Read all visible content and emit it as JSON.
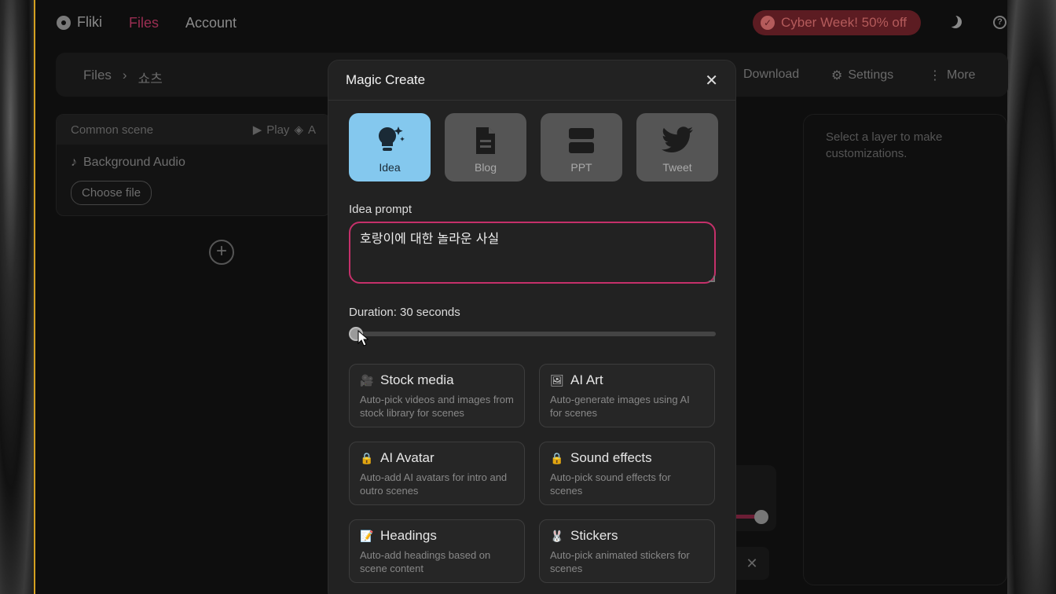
{
  "nav": {
    "brand": "Fliki",
    "files": "Files",
    "account": "Account",
    "promo": "Cyber Week! 50% off"
  },
  "toolbar": {
    "breadcrumb_root": "Files",
    "breadcrumb_sep": "›",
    "breadcrumb_current": "쇼츠",
    "download": "Download",
    "settings": "Settings",
    "more": "More"
  },
  "scene": {
    "title": "Common scene",
    "play": "Play",
    "extra": "A",
    "background_audio": "Background Audio",
    "choose_file": "Choose file"
  },
  "props": {
    "hint": "Select a layer to make customizations."
  },
  "modal": {
    "title": "Magic Create",
    "types": [
      {
        "label": "Idea",
        "icon": "lightbulb-sparkle-icon",
        "active": true
      },
      {
        "label": "Blog",
        "icon": "document-icon",
        "active": false
      },
      {
        "label": "PPT",
        "icon": "slides-icon",
        "active": false
      },
      {
        "label": "Tweet",
        "icon": "twitter-bird-icon",
        "active": false
      }
    ],
    "prompt_label": "Idea prompt",
    "prompt_value": "호랑이에 대한 놀라운 사실",
    "duration_label": "Duration: 30 seconds",
    "duration_level": 0,
    "features": [
      {
        "title": "Stock media",
        "desc": "Auto-pick videos and images from stock library for scenes",
        "icon": "film-camera-icon"
      },
      {
        "title": "AI Art",
        "desc": "Auto-generate images using AI for scenes",
        "icon": "picture-icon"
      },
      {
        "title": "AI Avatar",
        "desc": "Auto-add AI avatars for intro and outro scenes",
        "icon": "lock-icon"
      },
      {
        "title": "Sound effects",
        "desc": "Auto-pick sound effects for scenes",
        "icon": "lock-icon"
      },
      {
        "title": "Headings",
        "desc": "Auto-add headings based on scene content",
        "icon": "memo-icon"
      },
      {
        "title": "Stickers",
        "desc": "Auto-pick animated stickers for scenes",
        "icon": "rabbit-icon"
      }
    ]
  },
  "colors": {
    "accent_pink": "#c5306a",
    "active_tab": "#84c8ee",
    "promo_bg": "#5c1c22"
  }
}
